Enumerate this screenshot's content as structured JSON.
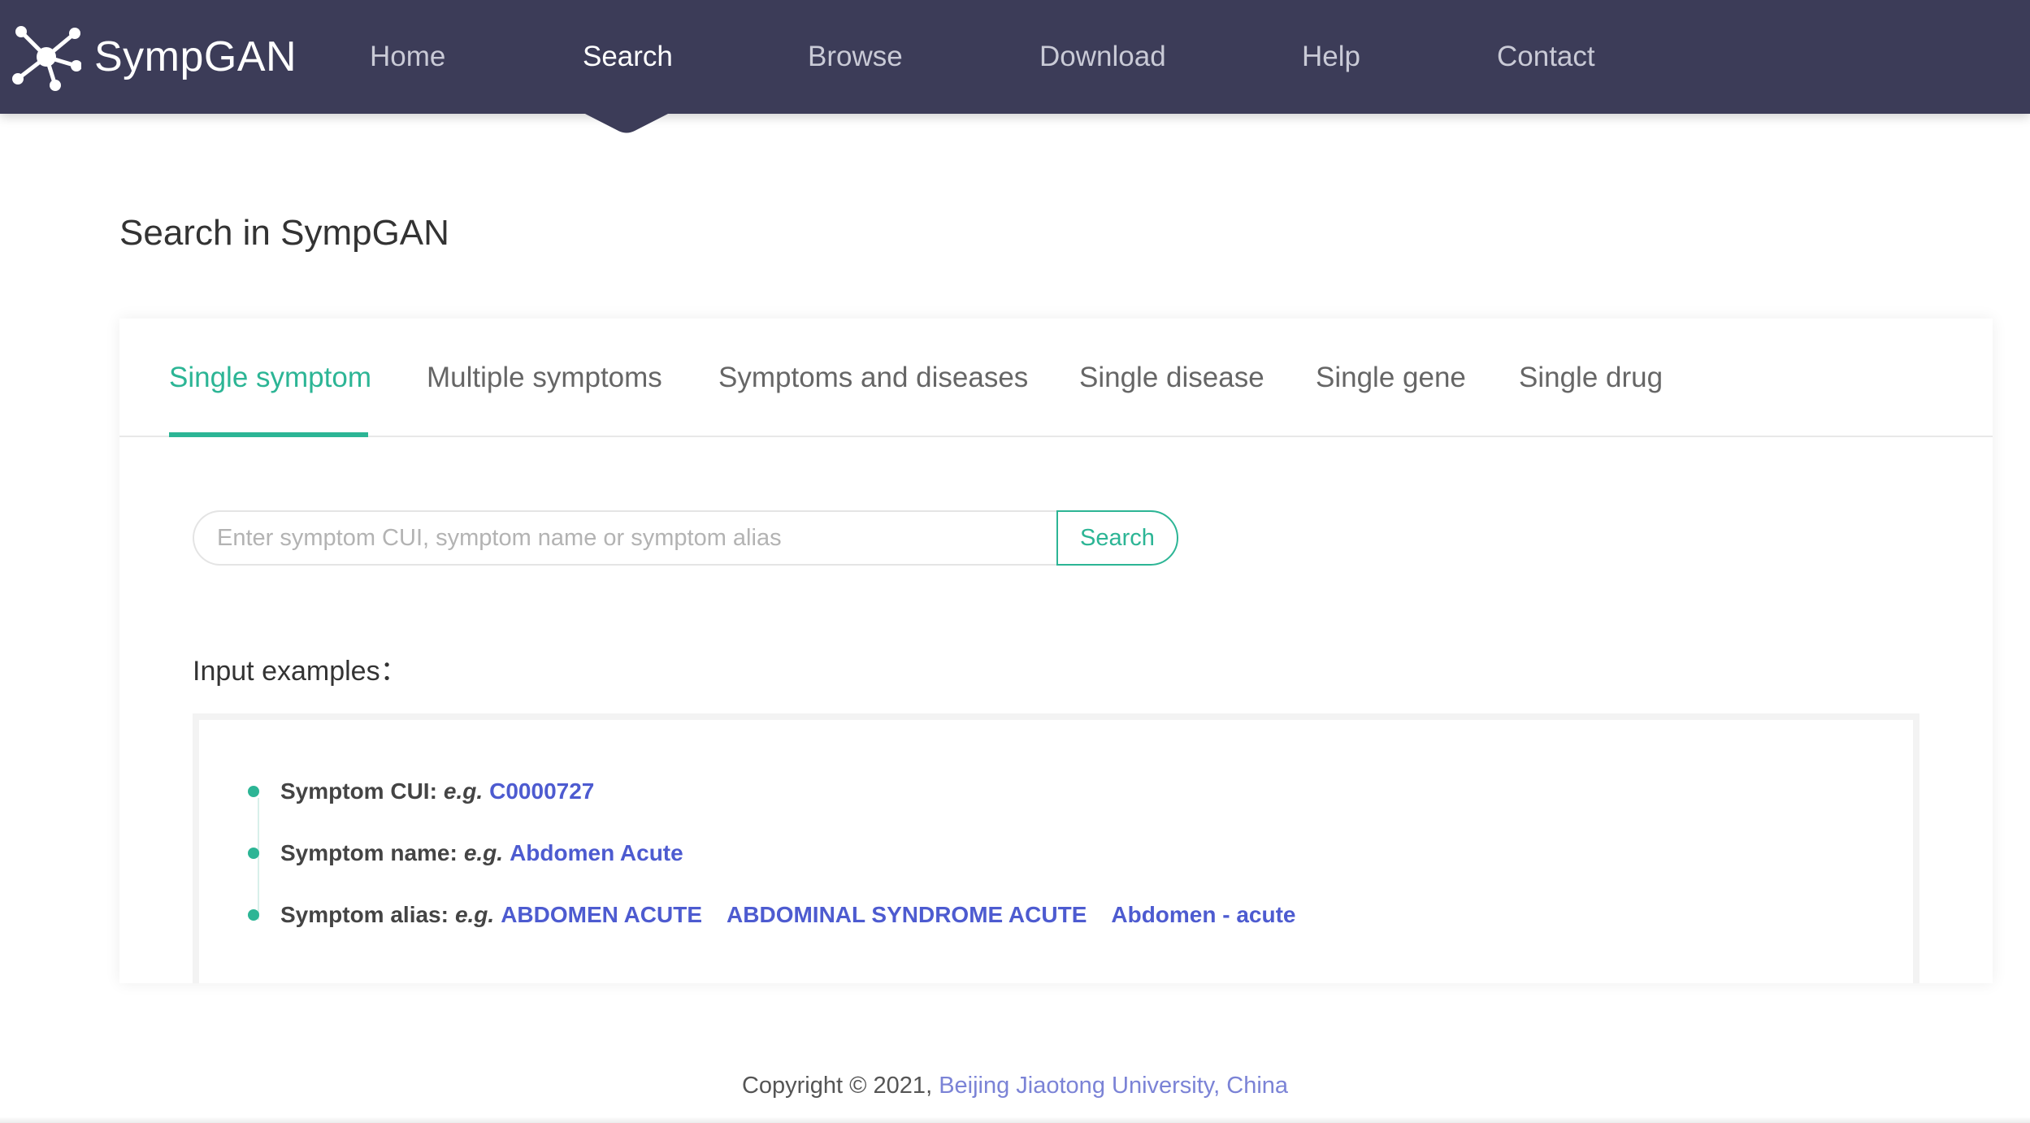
{
  "brand": {
    "name": "SympGAN"
  },
  "nav": {
    "items": [
      {
        "label": "Home"
      },
      {
        "label": "Search"
      },
      {
        "label": "Browse"
      },
      {
        "label": "Download"
      },
      {
        "label": "Help"
      },
      {
        "label": "Contact"
      }
    ],
    "active": "Search"
  },
  "page": {
    "title": "Search in SympGAN"
  },
  "tabs": {
    "items": [
      {
        "label": "Single symptom"
      },
      {
        "label": "Multiple symptoms"
      },
      {
        "label": "Symptoms and diseases"
      },
      {
        "label": "Single disease"
      },
      {
        "label": "Single gene"
      },
      {
        "label": "Single drug"
      }
    ],
    "active": "Single symptom"
  },
  "search": {
    "placeholder": "Enter symptom CUI, symptom name or symptom alias",
    "value": "",
    "button_label": "Search"
  },
  "examples": {
    "title": "Input examples：",
    "eg": "e.g.",
    "cui": {
      "label": "Symptom CUI:",
      "values": [
        "C0000727"
      ]
    },
    "name": {
      "label": "Symptom name:",
      "values": [
        "Abdomen Acute"
      ]
    },
    "alias": {
      "label": "Symptom alias:",
      "values": [
        "ABDOMEN ACUTE",
        "ABDOMINAL SYNDROME ACUTE",
        "Abdomen - acute"
      ]
    }
  },
  "footer": {
    "text": "Copyright © 2021, ",
    "link": "Beijing Jiaotong University, China"
  },
  "colors": {
    "nav_bg": "#3c3c58",
    "accent": "#2cb595",
    "link": "#4d5bd0"
  }
}
